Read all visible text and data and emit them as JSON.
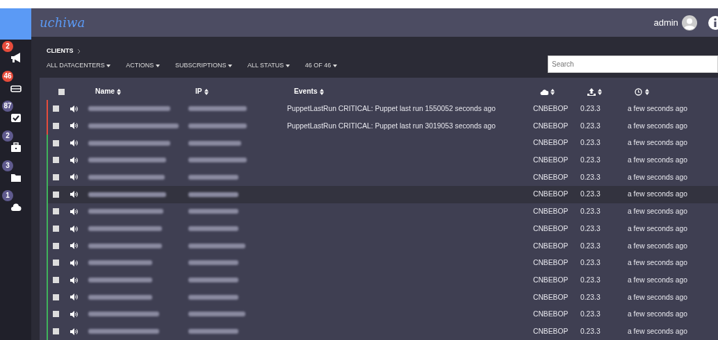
{
  "brand": "uchiwa",
  "user": {
    "name": "admin"
  },
  "sidebar": {
    "items": [
      {
        "kind": "events",
        "badge": "2",
        "color": "#e74c3c"
      },
      {
        "kind": "clients",
        "badge": "46",
        "color": "#e74c3c"
      },
      {
        "kind": "checks",
        "badge": "87",
        "color": "#5f5a8e"
      },
      {
        "kind": "stashes",
        "badge": "2",
        "color": "#5f5a8e"
      },
      {
        "kind": "aggregates",
        "badge": "3",
        "color": "#5f5a8e"
      },
      {
        "kind": "datacenters",
        "badge": "1",
        "color": "#5f5a8e"
      }
    ]
  },
  "breadcrumb": [
    "CLIENTS"
  ],
  "filters": [
    "ALL DATACENTERS",
    "ACTIONS",
    "SUBSCRIPTIONS",
    "ALL STATUS",
    "46 OF 46"
  ],
  "search": {
    "placeholder": "Search"
  },
  "table": {
    "columns": [
      {
        "kind": "select",
        "checked": false
      },
      {
        "kind": "silence"
      },
      {
        "kind": "text",
        "label": "Name"
      },
      {
        "kind": "text",
        "label": "IP"
      },
      {
        "kind": "text",
        "label": "Events"
      },
      {
        "kind": "datacenter"
      },
      {
        "kind": "version"
      },
      {
        "kind": "time"
      }
    ],
    "rows": [
      {
        "color": "#e74c3c",
        "checked": false,
        "selected": false,
        "events": "PuppetLastRun CRITICAL: Puppet last run 1550052 seconds ago",
        "datacenter": "CNBEBOP",
        "version": "0.23.3",
        "time": "a few seconds ago"
      },
      {
        "color": "#e74c3c",
        "checked": false,
        "selected": false,
        "events": "PuppetLastRun CRITICAL: Puppet last run 3019053 seconds ago",
        "datacenter": "CNBEBOP",
        "version": "0.23.3",
        "time": "a few seconds ago"
      },
      {
        "color": "#3fb35b",
        "checked": false,
        "selected": false,
        "datacenter": "CNBEBOP",
        "version": "0.23.3",
        "time": "a few seconds ago"
      },
      {
        "color": "#3fb35b",
        "checked": false,
        "selected": false,
        "datacenter": "CNBEBOP",
        "version": "0.23.3",
        "time": "a few seconds ago"
      },
      {
        "color": "#3fb35b",
        "checked": false,
        "selected": false,
        "datacenter": "CNBEBOP",
        "version": "0.23.3",
        "time": "a few seconds ago"
      },
      {
        "color": "#3fb35b",
        "checked": false,
        "selected": true,
        "datacenter": "CNBEBOP",
        "version": "0.23.3",
        "time": "a few seconds ago"
      },
      {
        "color": "#3fb35b",
        "checked": false,
        "selected": false,
        "datacenter": "CNBEBOP",
        "version": "0.23.3",
        "time": "a few seconds ago"
      },
      {
        "color": "#3fb35b",
        "checked": false,
        "selected": false,
        "datacenter": "CNBEBOP",
        "version": "0.23.3",
        "time": "a few seconds ago"
      },
      {
        "color": "#3fb35b",
        "checked": false,
        "selected": false,
        "datacenter": "CNBEBOP",
        "version": "0.23.3",
        "time": "a few seconds ago"
      },
      {
        "color": "#3fb35b",
        "checked": false,
        "selected": false,
        "datacenter": "CNBEBOP",
        "version": "0.23.3",
        "time": "a few seconds ago"
      },
      {
        "color": "#3fb35b",
        "checked": false,
        "selected": false,
        "datacenter": "CNBEBOP",
        "version": "0.23.3",
        "time": "a few seconds ago"
      },
      {
        "color": "#3fb35b",
        "checked": false,
        "selected": false,
        "datacenter": "CNBEBOP",
        "version": "0.23.3",
        "time": "a few seconds ago"
      },
      {
        "color": "#3fb35b",
        "checked": false,
        "selected": false,
        "datacenter": "CNBEBOP",
        "version": "0.23.3",
        "time": "a few seconds ago"
      },
      {
        "color": "#3fb35b",
        "checked": false,
        "selected": false,
        "datacenter": "CNBEBOP",
        "version": "0.23.3",
        "time": "a few seconds ago"
      }
    ]
  }
}
